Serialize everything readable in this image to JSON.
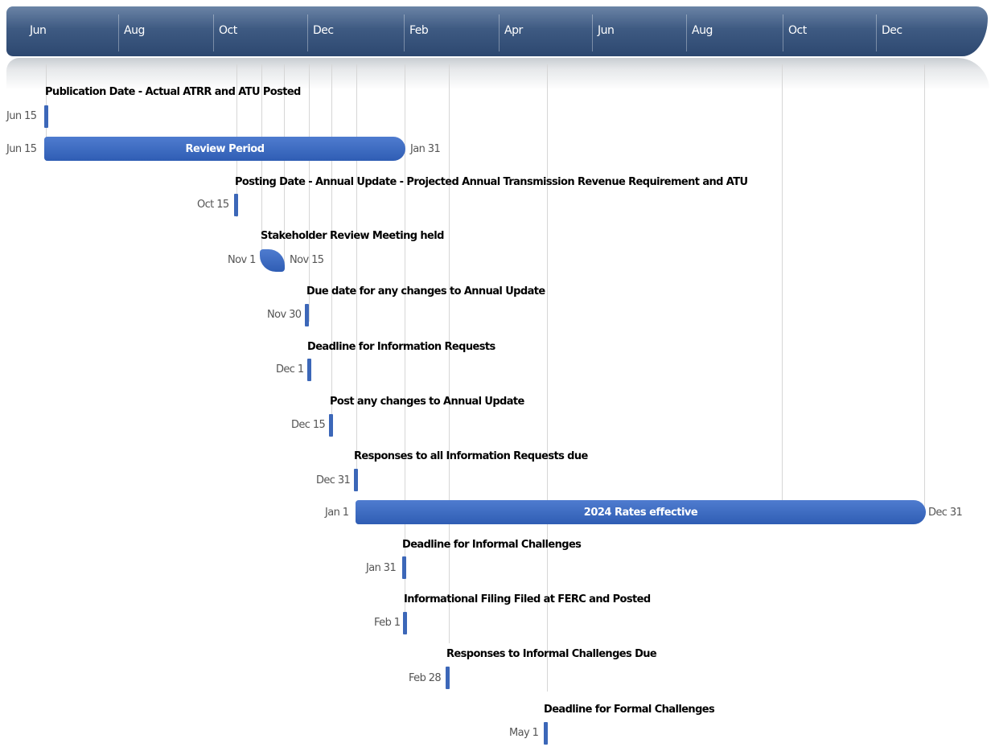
{
  "timeline": {
    "months": [
      "Jun",
      "Aug",
      "Oct",
      "Dec",
      "Feb",
      "Apr",
      "Jun",
      "Aug",
      "Oct",
      "Dec"
    ],
    "accent_color": "#3c67b8",
    "header_color": "#3e5a82"
  },
  "tasks": [
    {
      "title": "Publication Date - Actual ATRR and ATU Posted",
      "start": "Jun 15",
      "end": ""
    },
    {
      "title": "Review Period",
      "start": "Jun 15",
      "end": "Jan 31"
    },
    {
      "title": "Posting Date - Annual Update - Projected Annual Transmission Revenue Requirement and ATU",
      "start": "Oct 15",
      "end": ""
    },
    {
      "title": "Stakeholder Review Meeting held",
      "start": "Nov 1",
      "end": "Nov 15"
    },
    {
      "title": "Due date for any changes to Annual Update",
      "start": "Nov 30",
      "end": ""
    },
    {
      "title": "Deadline for Information Requests",
      "start": "Dec 1",
      "end": ""
    },
    {
      "title": "Post any changes to Annual Update",
      "start": "Dec 15",
      "end": ""
    },
    {
      "title": "Responses to all Information Requests due",
      "start": "Dec 31",
      "end": ""
    },
    {
      "title": "2024 Rates effective",
      "start": "Jan 1",
      "end": "Dec 31"
    },
    {
      "title": "Deadline for Informal Challenges",
      "start": "Jan 31",
      "end": ""
    },
    {
      "title": "Informational Filing Filed at FERC and Posted",
      "start": "Feb 1",
      "end": ""
    },
    {
      "title": "Responses to Informal Challenges Due",
      "start": "Feb 28",
      "end": ""
    },
    {
      "title": "Deadline for Formal Challenges",
      "start": "May 1",
      "end": ""
    }
  ]
}
